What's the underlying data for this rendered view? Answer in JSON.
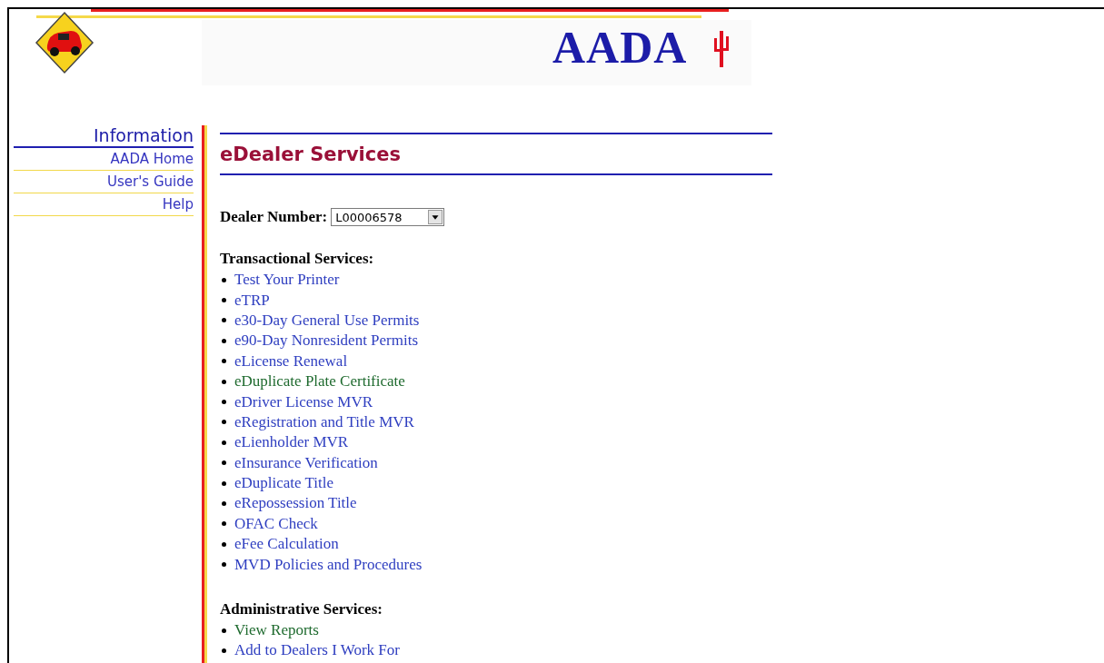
{
  "header": {
    "logo_text": "AADA"
  },
  "sidebar": {
    "title": "Information",
    "items": [
      {
        "label": "AADA Home"
      },
      {
        "label": "User's Guide"
      },
      {
        "label": "Help"
      }
    ]
  },
  "main": {
    "title": "eDealer Services",
    "dealer_field": {
      "label": "Dealer Number:",
      "value": "L00006578"
    },
    "sections": [
      {
        "heading": "Transactional Services:",
        "links": [
          {
            "label": "Test Your Printer",
            "visited": false
          },
          {
            "label": "eTRP",
            "visited": false
          },
          {
            "label": "e30-Day General Use Permits",
            "visited": false
          },
          {
            "label": "e90-Day Nonresident Permits",
            "visited": false
          },
          {
            "label": "eLicense Renewal",
            "visited": false
          },
          {
            "label": "eDuplicate Plate Certificate",
            "visited": true
          },
          {
            "label": "eDriver License MVR",
            "visited": false
          },
          {
            "label": "eRegistration and Title MVR",
            "visited": false
          },
          {
            "label": "eLienholder MVR",
            "visited": false
          },
          {
            "label": "eInsurance Verification",
            "visited": false
          },
          {
            "label": "eDuplicate Title",
            "visited": false
          },
          {
            "label": "eRepossession Title",
            "visited": false
          },
          {
            "label": "OFAC Check",
            "visited": false
          },
          {
            "label": "eFee Calculation",
            "visited": false
          },
          {
            "label": "MVD Policies and Procedures",
            "visited": false
          }
        ]
      },
      {
        "heading": "Administrative Services:",
        "links": [
          {
            "label": "View Reports",
            "visited": true
          },
          {
            "label": "Add to Dealers I Work For",
            "visited": false
          }
        ]
      }
    ]
  }
}
